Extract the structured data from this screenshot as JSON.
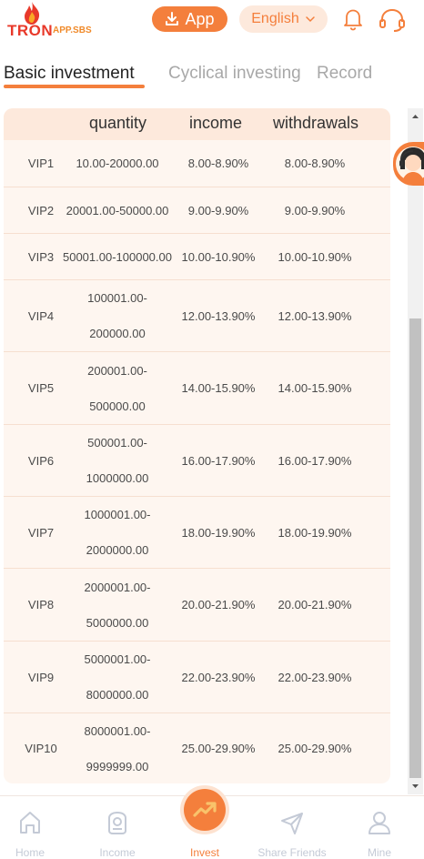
{
  "header": {
    "logo_text": "TRON",
    "logo_sub": "APP.SBS",
    "app_button": "App",
    "language": "English"
  },
  "tabs": [
    {
      "label": "Basic investment",
      "active": true
    },
    {
      "label": "Cyclical investing",
      "active": false
    },
    {
      "label": "Record",
      "active": false
    }
  ],
  "table": {
    "columns": [
      "quantity",
      "income",
      "withdrawals"
    ],
    "rows": [
      {
        "level": "VIP1",
        "quantity": "10.00-20000.00",
        "income": "8.00-8.90%",
        "withdrawals": "8.00-8.90%"
      },
      {
        "level": "VIP2",
        "quantity": "20001.00-50000.00",
        "income": "9.00-9.90%",
        "withdrawals": "9.00-9.90%"
      },
      {
        "level": "VIP3",
        "quantity": "50001.00-100000.00",
        "income": "10.00-10.90%",
        "withdrawals": "10.00-10.90%"
      },
      {
        "level": "VIP4",
        "quantity_line1": "100001.00-",
        "quantity_line2": "200000.00",
        "income": "12.00-13.90%",
        "withdrawals": "12.00-13.90%"
      },
      {
        "level": "VIP5",
        "quantity_line1": "200001.00-",
        "quantity_line2": "500000.00",
        "income": "14.00-15.90%",
        "withdrawals": "14.00-15.90%"
      },
      {
        "level": "VIP6",
        "quantity_line1": "500001.00-",
        "quantity_line2": "1000000.00",
        "income": "16.00-17.90%",
        "withdrawals": "16.00-17.90%"
      },
      {
        "level": "VIP7",
        "quantity_line1": "1000001.00-",
        "quantity_line2": "2000000.00",
        "income": "18.00-19.90%",
        "withdrawals": "18.00-19.90%"
      },
      {
        "level": "VIP8",
        "quantity_line1": "2000001.00-",
        "quantity_line2": "5000000.00",
        "income": "20.00-21.90%",
        "withdrawals": "20.00-21.90%"
      },
      {
        "level": "VIP9",
        "quantity_line1": "5000001.00-",
        "quantity_line2": "8000000.00",
        "income": "22.00-23.90%",
        "withdrawals": "22.00-23.90%"
      },
      {
        "level": "VIP10",
        "quantity_line1": "8000001.00-",
        "quantity_line2": "9999999.00",
        "income": "25.00-29.90%",
        "withdrawals": "25.00-29.90%"
      }
    ]
  },
  "bottom_nav": [
    {
      "label": "Home",
      "icon": "home-icon",
      "active": false
    },
    {
      "label": "Income",
      "icon": "wallet-icon",
      "active": false
    },
    {
      "label": "Invest",
      "icon": "trend-up-icon",
      "active": true
    },
    {
      "label": "Share Friends",
      "icon": "send-icon",
      "active": false
    },
    {
      "label": "Mine",
      "icon": "user-icon",
      "active": false
    }
  ],
  "colors": {
    "accent": "#f47f3c",
    "accent_light": "#fde9dc",
    "table_bg": "#fef6f0",
    "inactive_tab": "#a8a8a8",
    "inactive_nav": "#c4cad6"
  }
}
